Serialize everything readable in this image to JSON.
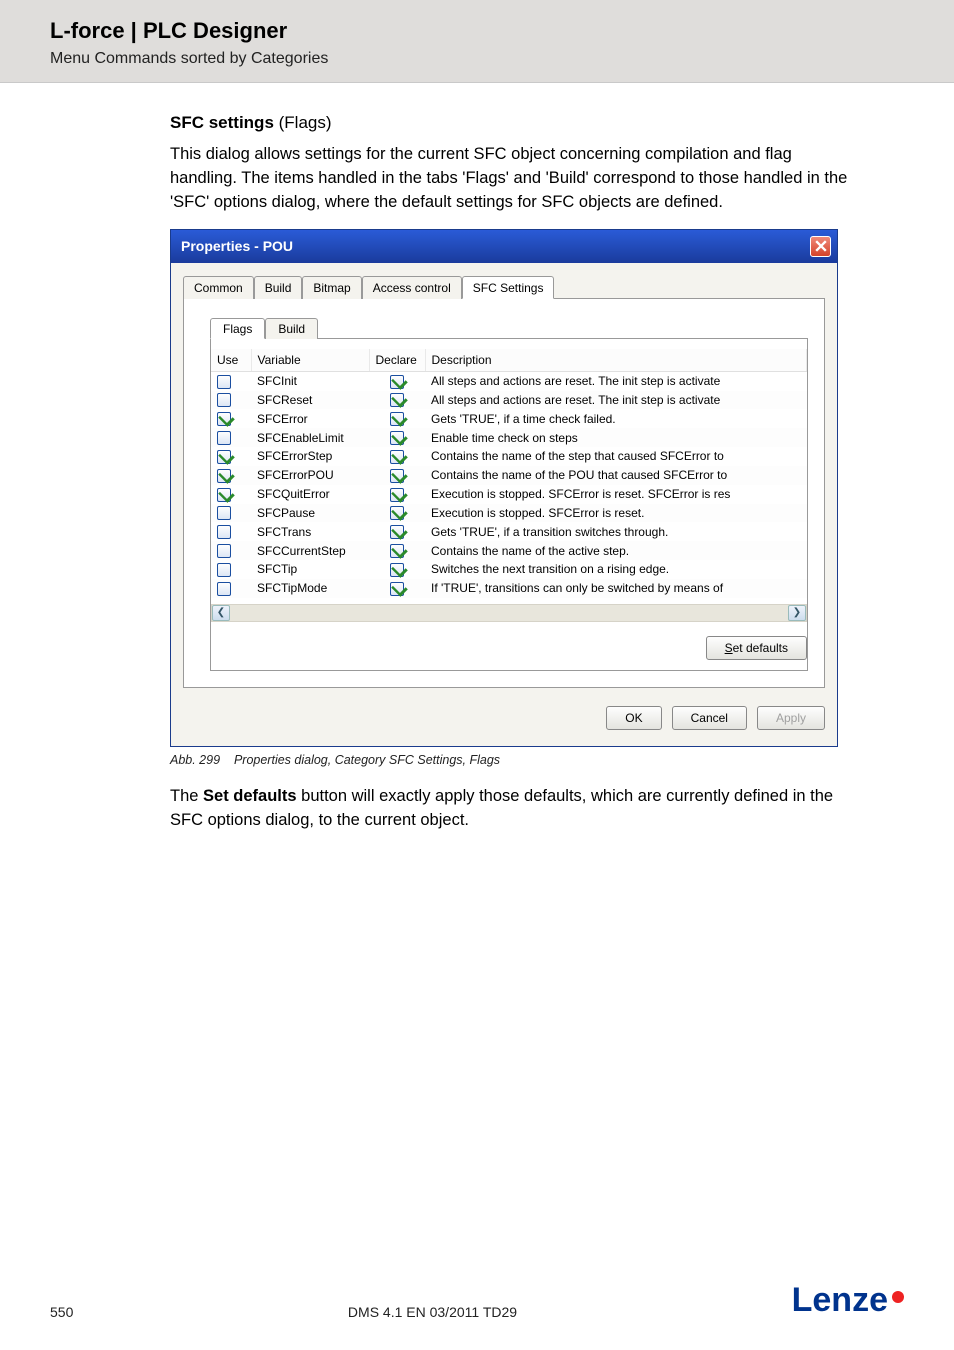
{
  "header": {
    "title": "L-force | PLC Designer",
    "subtitle": "Menu Commands sorted by Categories"
  },
  "section": {
    "heading_bold": "SFC settings",
    "heading_rest": " (Flags)",
    "para": "This dialog allows settings for the current SFC object concerning compilation and flag handling. The items handled in the tabs 'Flags' and 'Build' correspond to those handled in the 'SFC' options dialog, where the default settings for SFC objects are defined."
  },
  "dialog": {
    "title": "Properties - POU",
    "outer_tabs": [
      "Common",
      "Build",
      "Bitmap",
      "Access control",
      "SFC Settings"
    ],
    "outer_active": 4,
    "inner_tabs": [
      "Flags",
      "Build"
    ],
    "inner_active": 0,
    "columns": {
      "use": "Use",
      "variable": "Variable",
      "declare": "Declare",
      "description": "Description"
    },
    "rows": [
      {
        "use": false,
        "variable": "SFCInit",
        "declare": true,
        "desc": "All steps and actions are reset. The init step is activate"
      },
      {
        "use": false,
        "variable": "SFCReset",
        "declare": true,
        "desc": "All steps and actions are reset. The init step is activate"
      },
      {
        "use": true,
        "variable": "SFCError",
        "declare": true,
        "desc": "Gets 'TRUE', if a time check failed."
      },
      {
        "use": false,
        "variable": "SFCEnableLimit",
        "declare": true,
        "desc": "Enable time check on steps"
      },
      {
        "use": true,
        "variable": "SFCErrorStep",
        "declare": true,
        "desc": "Contains the name of the step that caused SFCError to"
      },
      {
        "use": true,
        "variable": "SFCErrorPOU",
        "declare": true,
        "desc": "Contains the name of the POU that caused SFCError to"
      },
      {
        "use": true,
        "variable": "SFCQuitError",
        "declare": true,
        "desc": "Execution is stopped. SFCError is reset. SFCError is res"
      },
      {
        "use": false,
        "variable": "SFCPause",
        "declare": true,
        "desc": "Execution is stopped. SFCError is reset."
      },
      {
        "use": false,
        "variable": "SFCTrans",
        "declare": true,
        "desc": "Gets 'TRUE', if a transition switches through."
      },
      {
        "use": false,
        "variable": "SFCCurrentStep",
        "declare": true,
        "desc": "Contains the name of the active step."
      },
      {
        "use": false,
        "variable": "SFCTip",
        "declare": true,
        "desc": "Switches the next transition on a rising edge."
      },
      {
        "use": false,
        "variable": "SFCTipMode",
        "declare": true,
        "desc": "If 'TRUE', transitions can only be switched by means of"
      }
    ],
    "set_defaults": "Set defaults",
    "ok": "OK",
    "cancel": "Cancel",
    "apply": "Apply"
  },
  "caption": {
    "abb": "Abb. 299",
    "text": "Properties dialog, Category SFC Settings, Flags"
  },
  "after_para_pre": "The ",
  "after_para_bold": "Set defaults",
  "after_para_post": " button will exactly apply those defaults, which are currently defined in the SFC options dialog, to the current object.",
  "footer": {
    "page": "550",
    "doc": "DMS 4.1 EN 03/2011 TD29",
    "brand": "Lenze"
  }
}
